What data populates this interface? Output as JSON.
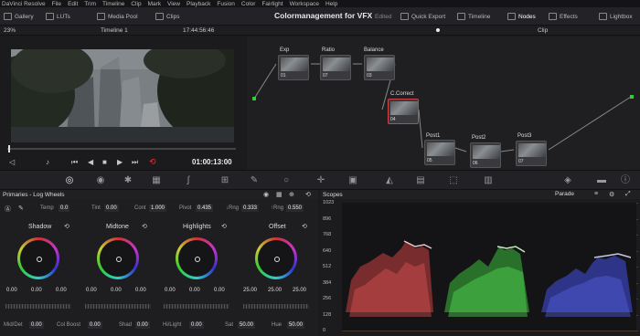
{
  "menu": [
    "DaVinci Resolve",
    "File",
    "Edit",
    "Trim",
    "Timeline",
    "Clip",
    "Mark",
    "View",
    "Playback",
    "Fusion",
    "Color",
    "Fairlight",
    "Workspace",
    "Help"
  ],
  "toolbar": {
    "gallery": "Gallery",
    "luts": "LUTs",
    "media_pool": "Media Pool",
    "clips": "Clips",
    "project_title": "Colormanagement for VFX",
    "edited": "Edited",
    "quick_export": "Quick Export",
    "timeline": "Timeline",
    "nodes": "Nodes",
    "effects": "Effects",
    "lightbox": "Lightbox"
  },
  "viewer": {
    "zoom": "23%",
    "timeline": "Timeline 1",
    "timecode_top": "17:44:56:46",
    "timecode": "01:00:13:00"
  },
  "nodes_hdr": {
    "clip": "Clip"
  },
  "nodes": [
    {
      "name": "Exp",
      "num": "01"
    },
    {
      "name": "Ratio",
      "num": "07"
    },
    {
      "name": "Balance",
      "num": "03"
    },
    {
      "name": "C.Correct",
      "num": "04"
    },
    {
      "name": "Post1",
      "num": "05"
    },
    {
      "name": "Post2",
      "num": "06"
    },
    {
      "name": "Post3",
      "num": "07"
    }
  ],
  "color": {
    "title": "Primaries - Log Wheels",
    "temp_label": "Temp",
    "temp": "0.0",
    "tint_label": "Tint",
    "tint": "0.00",
    "cont_label": "Cont",
    "cont": "1.000",
    "pivot_label": "Pivot",
    "pivot": "0.435",
    "lrng_label": "↓Rng",
    "lrng": "0.333",
    "hrng_label": "↑Rng",
    "hrng": "0.550",
    "wheels": [
      {
        "label": "Shadow",
        "v": [
          "0.00",
          "0.00",
          "0.00"
        ]
      },
      {
        "label": "Midtone",
        "v": [
          "0.00",
          "0.00",
          "0.00"
        ]
      },
      {
        "label": "Highlights",
        "v": [
          "0.00",
          "0.00",
          "0.00"
        ]
      },
      {
        "label": "Offset",
        "v": [
          "25.00",
          "25.00",
          "25.00"
        ]
      }
    ],
    "middet_label": "Mid/Det",
    "middet": "0.00",
    "colboost_label": "Col Boost",
    "colboost": "0.00",
    "shad_label": "Shad",
    "shad": "0.00",
    "hilight_label": "Hi/Light",
    "hilight": "0.00",
    "sat_label": "Sat",
    "sat": "50.00",
    "hue_label": "Hue",
    "hue": "50.00"
  },
  "scopes": {
    "title": "Scopes",
    "mode": "Parade",
    "levels": [
      "1023",
      "896",
      "768",
      "640",
      "512",
      "384",
      "256",
      "128",
      "0"
    ]
  },
  "colors": {
    "red": "#ff4040",
    "green": "#40ff40",
    "blue": "#5060ff",
    "accent": "#c44"
  }
}
